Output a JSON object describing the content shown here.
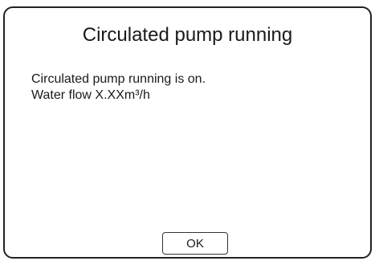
{
  "dialog": {
    "title": "Circulated pump running",
    "message_lines": [
      "Circulated pump running is on.",
      "Water flow X.XXm³/h"
    ],
    "ok_label": "OK"
  }
}
